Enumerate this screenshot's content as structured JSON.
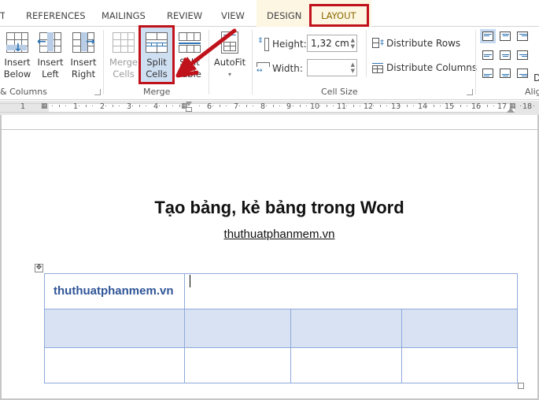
{
  "tabs": {
    "partial_left": "T",
    "items": [
      {
        "label": "REFERENCES"
      },
      {
        "label": "MAILINGS"
      },
      {
        "label": "REVIEW"
      },
      {
        "label": "VIEW"
      },
      {
        "label": "DESIGN"
      },
      {
        "label": "LAYOUT",
        "active": true
      }
    ]
  },
  "ribbon": {
    "rows_columns": {
      "group_label": "& Columns",
      "insert_below": {
        "line1": "Insert",
        "line2": "Below"
      },
      "insert_left": {
        "line1": "Insert",
        "line2": "Left"
      },
      "insert_right": {
        "line1": "Insert",
        "line2": "Right"
      }
    },
    "merge": {
      "group_label": "Merge",
      "merge_cells": {
        "line1": "Merge",
        "line2": "Cells",
        "enabled": false
      },
      "split_cells": {
        "line1": "Split",
        "line2": "Cells",
        "highlighted": true
      },
      "split_table": {
        "line1": "Split",
        "line2": "Table"
      }
    },
    "autofit": {
      "label": "AutoFit",
      "dropdown": "▾"
    },
    "cell_size": {
      "group_label": "Cell Size",
      "height_label": "Height:",
      "height_value": "1,32 cm",
      "width_label": "Width:",
      "width_value": "",
      "distribute_rows": "Distribute Rows",
      "distribute_columns": "Distribute Columns"
    },
    "alignment": {
      "group_label": "Alig",
      "partial_text": "D",
      "selected": "top-left"
    }
  },
  "ruler": {
    "left_numbers": [
      "1"
    ],
    "numbers": [
      "1",
      "2",
      "3",
      "4",
      "6",
      "7",
      "8",
      "9",
      "10",
      "11",
      "12",
      "13",
      "14",
      "15",
      "16",
      "17",
      "18"
    ]
  },
  "document": {
    "title": "Tạo bảng, kẻ bảng trong Word",
    "subtitle": "thuthuatphanmem.vn",
    "table": {
      "rows": [
        {
          "cells": [
            "thuthuatphanmem.vn",
            ""
          ],
          "shaded": false
        },
        {
          "cells": [
            "",
            "",
            "",
            ""
          ],
          "shaded": true
        },
        {
          "cells": [
            "",
            "",
            "",
            ""
          ],
          "shaded": false
        }
      ]
    }
  },
  "colors": {
    "highlight_red": "#c0121a",
    "table_border": "#8eaadb",
    "table_shade": "#d9e2f3",
    "cell_text": "#2f5597",
    "contextual_tab_bg": "#fdf6e3",
    "active_tab_text": "#8a6a00"
  }
}
